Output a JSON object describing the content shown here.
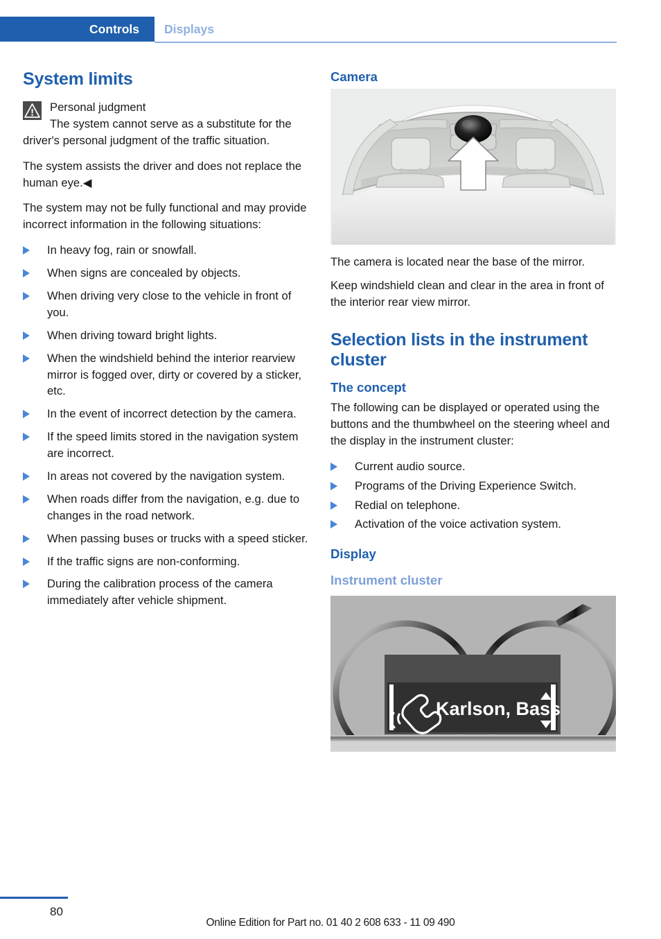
{
  "header": {
    "tab_active": "Controls",
    "tab_inactive": "Displays",
    "accent_color": "#1f5fad",
    "inactive_color": "#8fb0e0"
  },
  "left_column": {
    "section_title": "System limits",
    "note": {
      "icon": "warning-triangle-icon",
      "title": "Personal judgment",
      "text": "The system cannot serve as a substitute for the driver's personal judgment of the traffic situation."
    },
    "paragraph_1": "The system assists the driver and does not replace the human eye.◀",
    "paragraph_2": "The system may not be fully functional and may provide incorrect information in the following situations:",
    "bullets": [
      "In heavy fog, rain or snowfall.",
      "When signs are concealed by objects.",
      "When driving very close to the vehicle in front of you.",
      "When driving toward bright lights.",
      "When the windshield behind the interior rearview mirror is fogged over, dirty or covered by a sticker, etc.",
      "In the event of incorrect detection by the camera.",
      "If the speed limits stored in the navigation system are incorrect.",
      "In areas not covered by the navigation system.",
      "When roads differ from the navigation, e.g. due to changes in the road network.",
      "When passing buses or trucks with a speed sticker.",
      "If the traffic signs are non-conforming.",
      "During the calibration process of the camera immediately after vehicle shipment."
    ]
  },
  "right_column": {
    "camera": {
      "heading": "Camera",
      "figure_name": "windshield-camera-illustration",
      "paragraph_1": "The camera is located near the base of the mirror.",
      "paragraph_2": "Keep windshield clean and clear in the area in front of the interior rear view mirror."
    },
    "selection_lists": {
      "section_title": "Selection lists in the instrument cluster",
      "concept_heading": "The concept",
      "concept_text": "The following can be displayed or operated using the buttons and the thumbwheel on the steering wheel and the display in the instrument cluster:",
      "bullets": [
        "Current audio source.",
        "Programs of the Driving Experience Switch.",
        "Redial on telephone.",
        "Activation of the voice activation system."
      ],
      "display_heading": "Display",
      "cluster_subheading": "Instrument cluster",
      "cluster_figure": {
        "figure_name": "instrument-cluster-illustration",
        "list_entry": "Karlson, Bass",
        "icon": "telephone-handset-icon",
        "scroll_up": "▲",
        "scroll_down": "▼"
      }
    }
  },
  "footer": {
    "page_number": "80",
    "edition_text": "Online Edition for Part no. 01 40 2 608 633 - 11 09 490"
  }
}
